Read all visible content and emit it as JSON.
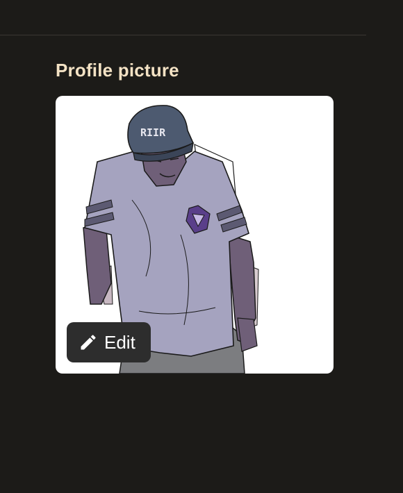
{
  "profile": {
    "section_title": "Profile picture",
    "avatar": {
      "cap_text": "RIIR",
      "edit_button_label": "Edit",
      "edit_icon": "pencil-icon"
    }
  },
  "colors": {
    "background": "#1c1b18",
    "divider": "#3a3833",
    "title": "#f3e2c4",
    "edit_button_bg": "#2d2d2d",
    "edit_button_text": "#ffffff"
  }
}
